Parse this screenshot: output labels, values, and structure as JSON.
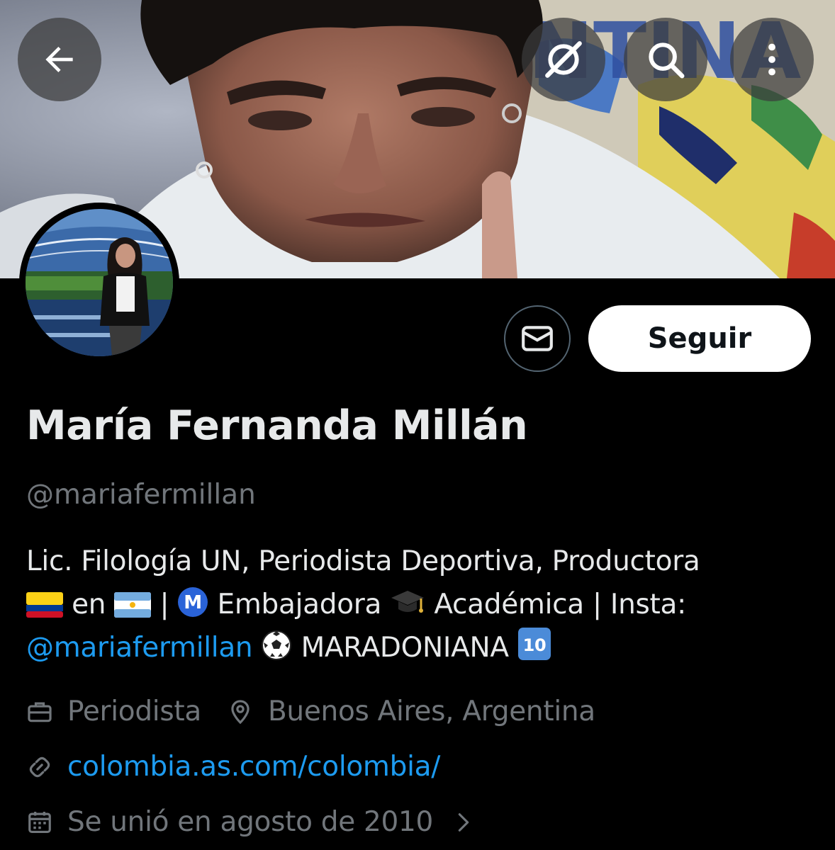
{
  "header": {
    "back_icon": "arrow-left-icon",
    "grok_icon": "grok-icon",
    "search_icon": "search-icon",
    "more_icon": "more-vertical-icon"
  },
  "profile": {
    "display_name": "María Fernanda Millán",
    "handle": "@mariafermillan",
    "follow_label": "Seguir",
    "message_icon": "envelope-icon",
    "bio": {
      "line1": "Lic. Filología UN, Periodista Deportiva, Productora",
      "line2_en": "en",
      "line2_sep": "|",
      "line2_embajadora": "Embajadora",
      "line2_academica": "Académica | Insta:",
      "line3_mention": "@mariafermillan",
      "line3_text": "MARADONIANA",
      "emojis": [
        "flag-colombia",
        "flag-argentina",
        "circled-m",
        "graduation-cap",
        "soccer-ball",
        "keycap-10"
      ]
    },
    "profession": "Periodista",
    "location": "Buenos Aires, Argentina",
    "website": "colombia.as.com/colombia/",
    "joined": "Se unió en agosto de 2010"
  },
  "colors": {
    "background": "#000000",
    "text": "#e7e9ea",
    "secondary_text": "#71767b",
    "link": "#1d9bf0",
    "button_bg": "#ffffff"
  }
}
